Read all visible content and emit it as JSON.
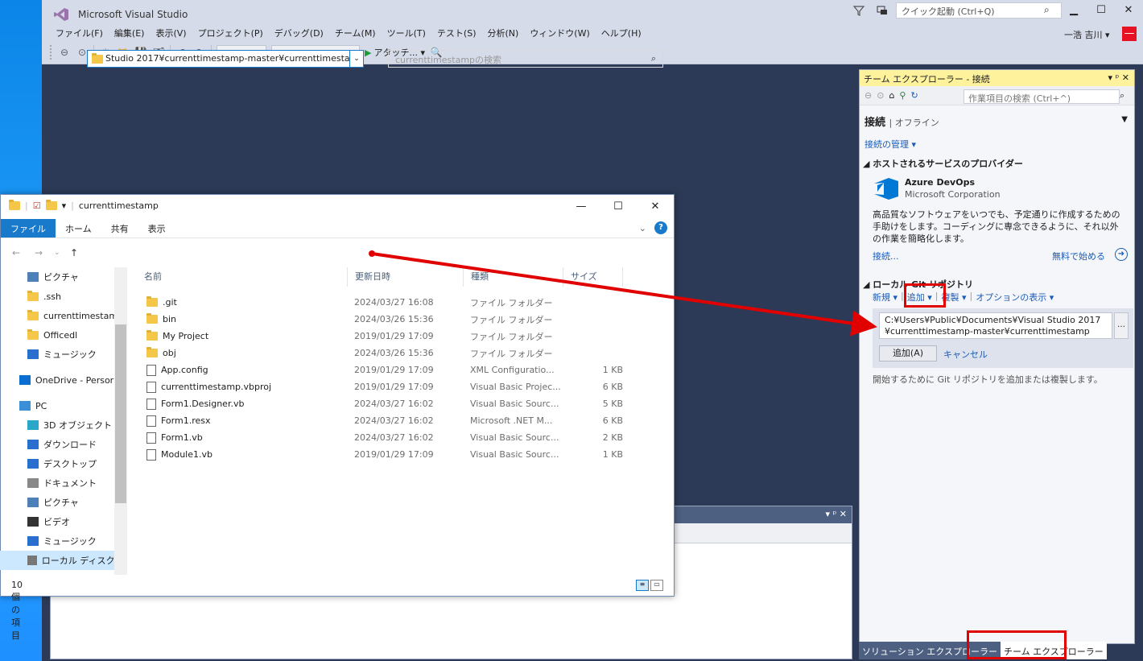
{
  "vs": {
    "title": "Microsoft Visual Studio",
    "quick_launch_placeholder": "クイック起動 (Ctrl+Q)",
    "user_name": "一浩 吉川 ▾",
    "user_badge": "—",
    "menu": [
      "ファイル(F)",
      "編集(E)",
      "表示(V)",
      "プロジェクト(P)",
      "デバッグ(D)",
      "チーム(M)",
      "ツール(T)",
      "テスト(S)",
      "分析(N)",
      "ウィンドウ(W)",
      "ヘルプ(H)"
    ],
    "toolbar": {
      "attach_label": "アタッチ... ▾"
    }
  },
  "team": {
    "header": "チーム エクスプローラー - 接続",
    "header_controls": "▾ ᵖ ✕",
    "search_placeholder": "作業項目の検索 (Ctrl+^)",
    "connect_title": "接続",
    "connect_status": "| オフライン",
    "manage_connections": "接続の管理 ▾",
    "hosted_title": "◢ ホストされるサービスのプロバイダー",
    "azure_name": "Azure DevOps",
    "azure_corp": "Microsoft Corporation",
    "azure_desc": "高品質なソフトウェアをいつでも、予定通りに作成するための手助けをします。コーディングに専念できるように、それ以外の作業を簡略化します。",
    "azure_connect": "接続...",
    "azure_free": "無料で始める",
    "local_title": "◢ ローカル Git リポジトリ",
    "local_actions": [
      "新規 ▾",
      "追加 ▾",
      "複製 ▾",
      "オプションの表示 ▾"
    ],
    "add_path_line1": "C:¥Users¥Public¥Documents¥Visual Studio 2017",
    "add_path_line2": "¥currenttimestamp-master¥currenttimestamp",
    "add_button": "追加(A)",
    "cancel": "キャンセル",
    "start_hint": "開始するために Git リポジトリを追加または複製します。"
  },
  "bottom_tabs": [
    "ソリューション エクスプローラー",
    "チーム エクスプローラー"
  ],
  "explorer": {
    "title": "currenttimestamp",
    "ribbon_tabs": [
      "ファイル",
      "ホーム",
      "共有",
      "表示"
    ],
    "address": "Studio 2017¥currenttimestamp-master¥currenttimestamp",
    "search_placeholder": "currenttimestampの検索",
    "nav_items": [
      {
        "label": "ピクチャ",
        "icon": "pictures-icon"
      },
      {
        "label": ".ssh",
        "icon": "folder-icon"
      },
      {
        "label": "currenttimestam",
        "icon": "folder-icon"
      },
      {
        "label": "Officedl",
        "icon": "folder-icon"
      },
      {
        "label": "ミュージック",
        "icon": "music-icon"
      },
      {
        "label": "OneDrive - Persor",
        "icon": "onedrive-icon"
      },
      {
        "label": "PC",
        "icon": "pc-icon"
      },
      {
        "label": "3D オブジェクト",
        "icon": "3d-objects-icon"
      },
      {
        "label": "ダウンロード",
        "icon": "download-icon"
      },
      {
        "label": "デスクトップ",
        "icon": "desktop-icon"
      },
      {
        "label": "ドキュメント",
        "icon": "documents-icon"
      },
      {
        "label": "ピクチャ",
        "icon": "pictures-icon"
      },
      {
        "label": "ビデオ",
        "icon": "video-icon"
      },
      {
        "label": "ミュージック",
        "icon": "music-icon"
      },
      {
        "label": "ローカル ディスク (C",
        "icon": "disk-icon"
      }
    ],
    "columns": [
      "名前",
      "更新日時",
      "種類",
      "サイズ"
    ],
    "files": [
      {
        "name": ".git",
        "date": "2024/03/27 16:08",
        "type": "ファイル フォルダー",
        "size": "",
        "icon": "folder-icon"
      },
      {
        "name": "bin",
        "date": "2024/03/26 15:36",
        "type": "ファイル フォルダー",
        "size": "",
        "icon": "folder-icon"
      },
      {
        "name": "My Project",
        "date": "2019/01/29 17:09",
        "type": "ファイル フォルダー",
        "size": "",
        "icon": "folder-icon"
      },
      {
        "name": "obj",
        "date": "2024/03/26 15:36",
        "type": "ファイル フォルダー",
        "size": "",
        "icon": "folder-icon"
      },
      {
        "name": "App.config",
        "date": "2019/01/29 17:09",
        "type": "XML Configuratio...",
        "size": "1 KB",
        "icon": "config-file-icon"
      },
      {
        "name": "currenttimestamp.vbproj",
        "date": "2019/01/29 17:09",
        "type": "Visual Basic Projec...",
        "size": "6 KB",
        "icon": "file-icon"
      },
      {
        "name": "Form1.Designer.vb",
        "date": "2024/03/27 16:02",
        "type": "Visual Basic Sourc...",
        "size": "5 KB",
        "icon": "vb-file-icon"
      },
      {
        "name": "Form1.resx",
        "date": "2024/03/27 16:02",
        "type": "Microsoft .NET M...",
        "size": "6 KB",
        "icon": "resx-file-icon"
      },
      {
        "name": "Form1.vb",
        "date": "2024/03/27 16:02",
        "type": "Visual Basic Sourc...",
        "size": "2 KB",
        "icon": "vb-file-icon"
      },
      {
        "name": "Module1.vb",
        "date": "2019/01/29 17:09",
        "type": "Visual Basic Sourc...",
        "size": "1 KB",
        "icon": "vb-file-icon"
      }
    ],
    "status": "10 個の項目"
  },
  "colors": {
    "highlight_red": "#e00000",
    "accent_blue": "#1979ca",
    "vs_dark": "#2c3a57"
  }
}
